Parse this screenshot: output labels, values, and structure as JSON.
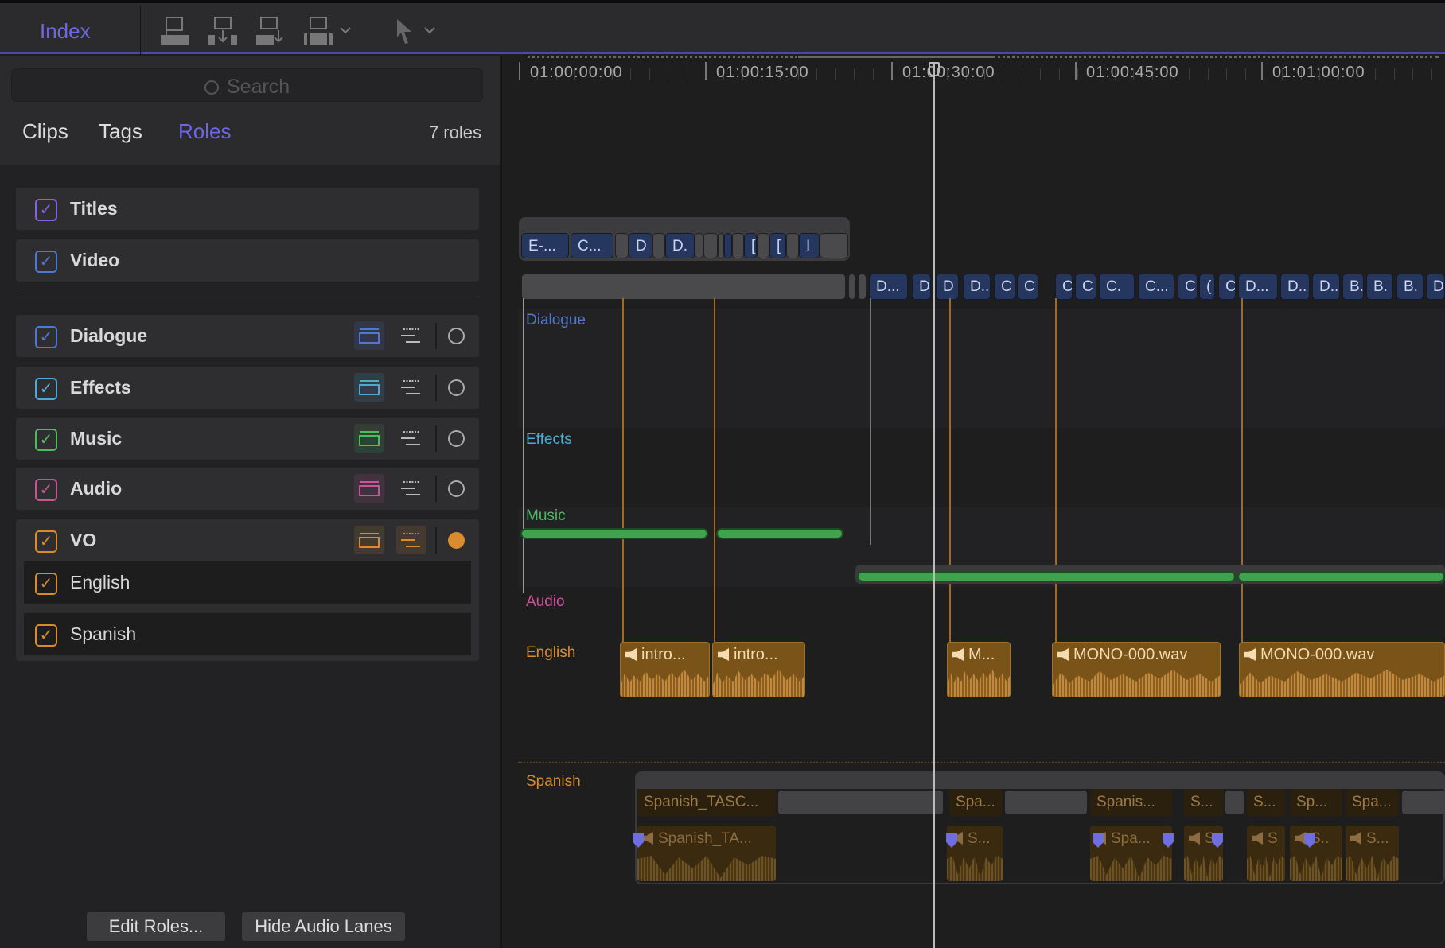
{
  "toolbar": {
    "index_label": "Index",
    "icons": [
      "append-clip-icon",
      "insert-clip-icon",
      "overwrite-clip-icon",
      "connect-clip-icon",
      "select-tool-icon"
    ]
  },
  "index": {
    "search_placeholder": "Search",
    "tabs": [
      {
        "label": "Clips"
      },
      {
        "label": "Tags"
      },
      {
        "label": "Roles",
        "active": true
      }
    ],
    "roles_count": "7 roles"
  },
  "roles": [
    {
      "label": "Titles",
      "color": "#8a62dc",
      "checked": true
    },
    {
      "label": "Video",
      "color": "#4f78d0",
      "checked": true
    },
    {
      "label": "Dialogue",
      "color": "#4f78d0",
      "checked": true
    },
    {
      "label": "Effects",
      "color": "#4fa9d6",
      "checked": true
    },
    {
      "label": "Music",
      "color": "#4cbc62",
      "checked": true
    },
    {
      "label": "Audio",
      "color": "#c8549a",
      "checked": true
    },
    {
      "label": "VO",
      "color": "#d88c2e",
      "checked": true,
      "focused": true
    },
    {
      "label": "English",
      "color": "#d88c2e",
      "checked": true
    },
    {
      "label": "Spanish",
      "color": "#d88c2e",
      "checked": true
    }
  ],
  "buttons": {
    "edit_roles": "Edit Roles...",
    "hide_audio_lanes": "Hide Audio Lanes"
  },
  "timeline": {
    "timecodes": [
      "01:00:00:00",
      "01:00:15:00",
      "01:00:30:00",
      "01:00:45:00",
      "01:01:00:00"
    ],
    "playhead": "01:00:29:00",
    "lanes": {
      "dialogue": "Dialogue",
      "effects": "Effects",
      "music": "Music",
      "audio": "Audio",
      "english": "English",
      "spanish": "Spanish"
    },
    "title_clips": [
      "E-...",
      "C...",
      "",
      "D",
      "",
      "D.",
      "",
      "",
      "",
      "I",
      "",
      "[",
      "",
      "[",
      "",
      "I",
      ""
    ],
    "primary_clips": [
      "",
      "",
      "",
      "D...",
      "D",
      "D",
      "D..",
      "C",
      "C",
      "C",
      "C",
      "C.",
      "C...",
      "C",
      "(",
      "C",
      "D...",
      "D..",
      "D..",
      "B.",
      "B.",
      "B.",
      "D"
    ],
    "english_clips": [
      "intro...",
      "intro...",
      "M...",
      "MONO-000.wav",
      "MONO-000.wav"
    ],
    "spanish_upper": [
      "Spanish_TASC...",
      "",
      "Spa...",
      "",
      "Spanis...",
      "S...",
      "",
      "S...",
      "Sp...",
      "Spa...",
      ""
    ],
    "spanish_lower": [
      "Spanish_TA...",
      "S...",
      "Spa...",
      "S",
      "S",
      "S..",
      "S..."
    ]
  }
}
